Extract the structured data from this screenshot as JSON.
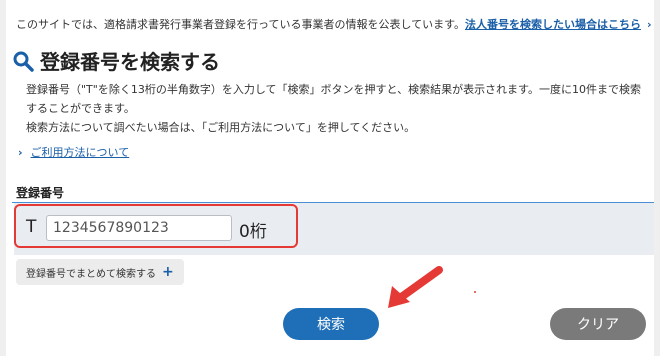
{
  "header": {
    "intro": "このサイトでは、適格請求書発行事業者登録を行っている事業者の情報を公表しています。",
    "corp_link": "法人番号を検索したい場合はこちら",
    "corp_link_icon": "chevron-right-icon"
  },
  "title": {
    "text": "登録番号を検索する",
    "icon": "magnifier-icon"
  },
  "description": {
    "line1": "登録番号（\"T\"を除く13桁の半角数字）を入力して「検索」ボタンを押すと、検索結果が表示されます。一度に10件まで検索することができます。",
    "line2": "検索方法について調べたい場合は、「ご利用方法について」を押してください。"
  },
  "howto_link": {
    "label": "ご利用方法について",
    "icon": "chevron-right-icon"
  },
  "field": {
    "label": "登録番号",
    "prefix": "T",
    "value": "1234567890123",
    "digit_count": "0桁"
  },
  "bulk_button": {
    "label": "登録番号でまとめて検索する",
    "icon": "plus-icon"
  },
  "buttons": {
    "search": "検索",
    "clear": "クリア"
  },
  "colors": {
    "accent": "#1f6fb8",
    "link": "#1a5fa8",
    "highlight": "#e53935",
    "clear_button": "#7a7a7a"
  }
}
